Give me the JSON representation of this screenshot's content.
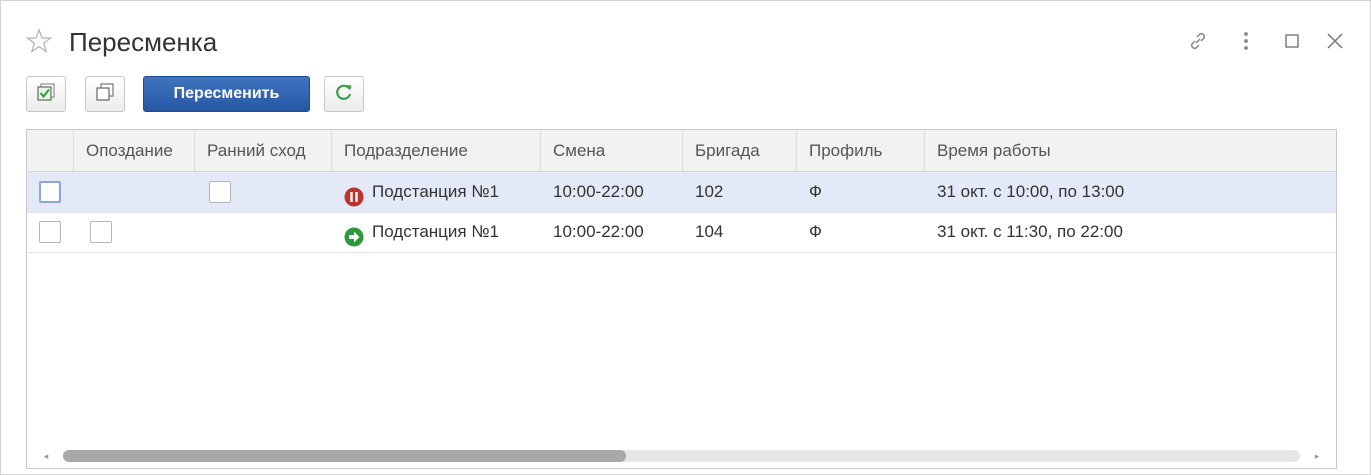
{
  "window": {
    "title": "Пересменка",
    "icons": [
      "star-icon",
      "link-icon",
      "more-vertical-icon",
      "maximize-icon",
      "close-icon"
    ]
  },
  "toolbar": {
    "select_all_icon": "check-all-icon",
    "copy_icon": "copy-icon",
    "main_button_label": "Пересменить",
    "refresh_icon": "refresh-icon",
    "main_button_color": "#2f62ae"
  },
  "table": {
    "columns": [
      "",
      "Опоздание",
      "Ранний сход",
      "Подразделение",
      "Смена",
      "Бригада",
      "Профиль",
      "Время работы"
    ],
    "rows": [
      {
        "selected": true,
        "checked": false,
        "late": null,
        "early_leave": false,
        "status_icon": "pause-red-icon",
        "unit": "Подстанция №1",
        "shift": "10:00-22:00",
        "brigade": "102",
        "profile": "Ф",
        "work_time": "31 окт. с 10:00, по 13:00"
      },
      {
        "selected": false,
        "checked": false,
        "late": false,
        "early_leave": null,
        "status_icon": "arrow-right-green-icon",
        "unit": "Подстанция №1",
        "shift": "10:00-22:00",
        "brigade": "104",
        "profile": "Ф",
        "work_time": "31 окт. с 11:30, по 22:00"
      }
    ]
  },
  "scrollbar": {
    "position": 0
  },
  "colors": {
    "selected_row": "#e3e9f6",
    "status_red": "#c0322d",
    "status_green": "#2a9a3a",
    "refresh_green": "#3aa04a"
  }
}
